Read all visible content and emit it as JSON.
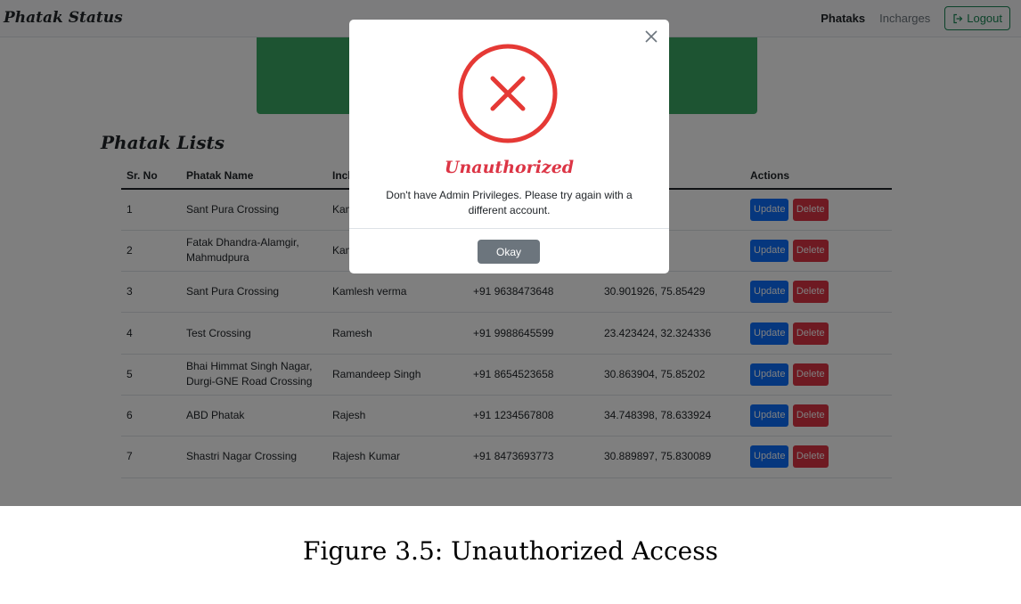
{
  "navbar": {
    "brand": "Phatak Status",
    "links": [
      {
        "label": "Phataks",
        "active": true
      },
      {
        "label": "Incharges",
        "active": false
      }
    ],
    "logout_label": "Logout",
    "logout_icon": "logout-icon"
  },
  "section_title": "Phatak Lists",
  "table": {
    "headers": [
      "Sr. No",
      "Phatak Name",
      "Inch",
      "Actions"
    ],
    "rows": [
      {
        "sr": "1",
        "name": "Sant Pura Crossing",
        "incharge": "Kam",
        "phone": "",
        "location": "85429"
      },
      {
        "sr": "2",
        "name": "Fatak Dhandra-Alamgir, Mahmudpura",
        "incharge": "Kam",
        "phone": "",
        "location": "841446"
      },
      {
        "sr": "3",
        "name": "Sant Pura Crossing",
        "incharge": "Kamlesh verma",
        "phone": "+91 9638473648",
        "location": "30.901926, 75.85429"
      },
      {
        "sr": "4",
        "name": "Test Crossing",
        "incharge": "Ramesh",
        "phone": "+91 9988645599",
        "location": "23.423424, 32.324336"
      },
      {
        "sr": "5",
        "name": "Bhai Himmat Singh Nagar, Durgi-GNE Road Crossing",
        "incharge": "Ramandeep Singh",
        "phone": "+91 8654523658",
        "location": "30.863904, 75.85202"
      },
      {
        "sr": "6",
        "name": "ABD Phatak",
        "incharge": "Rajesh",
        "phone": "+91 1234567808",
        "location": "34.748398, 78.633924"
      },
      {
        "sr": "7",
        "name": "Shastri Nagar Crossing",
        "incharge": "Rajesh Kumar",
        "phone": "+91 8473693773",
        "location": "30.889897, 75.830089"
      }
    ],
    "update_label": "Update",
    "delete_label": "Delete"
  },
  "modal": {
    "title": "Unauthorized",
    "message": "Don't have Admin Privileges. Please try again with a different account.",
    "ok_label": "Okay",
    "icon": "error-x-circle-icon",
    "close_icon": "close-icon"
  },
  "caption": "Figure 3.5: Unauthorized Access",
  "colors": {
    "banner": "#3aa864",
    "update": "#0d6efd",
    "delete": "#dc3545",
    "error": "#e53935",
    "logout": "#198754",
    "okay": "#6c757d"
  }
}
